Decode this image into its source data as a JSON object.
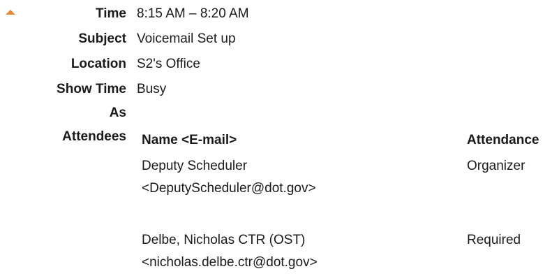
{
  "fields": {
    "time_label": "Time",
    "time_value": "8:15 AM – 8:20 AM",
    "subject_label": "Subject",
    "subject_value": "Voicemail Set up",
    "location_label": "Location",
    "location_value": "S2's Office",
    "show_time_label_line1": "Show Time",
    "show_time_label_line2": "As",
    "show_time_value": "Busy",
    "attendees_label": "Attendees"
  },
  "attendees_table": {
    "headers": {
      "name": "Name <E-mail>",
      "attendance": "Attendance"
    },
    "rows": [
      {
        "name": "Deputy Scheduler",
        "email": "<DeputyScheduler@dot.gov>",
        "attendance": "Organizer"
      },
      {
        "name": "Delbe, Nicholas CTR (OST)",
        "email": "<nicholas.delbe.ctr@dot.gov>",
        "attendance": "Required"
      }
    ]
  },
  "colors": {
    "marker": "#e8873a",
    "text": "#1a1a1a"
  }
}
